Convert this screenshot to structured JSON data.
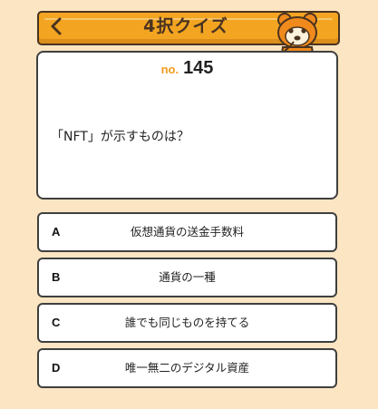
{
  "header": {
    "title": "4択クイズ",
    "back_icon": "chevron-left-icon"
  },
  "question": {
    "number_label": "no.",
    "number": "145",
    "text": "「NFT」が示すものは？"
  },
  "answers": [
    {
      "letter": "A",
      "text": "仮想通貨の送金手数料"
    },
    {
      "letter": "B",
      "text": "通貨の一種"
    },
    {
      "letter": "C",
      "text": "誰でも同じものを持てる"
    },
    {
      "letter": "D",
      "text": "唯一無二のデジタル資産"
    }
  ],
  "colors": {
    "background": "#fbe5c2",
    "banner": "#f3a521",
    "accent": "#f39c1a",
    "border": "#3f3f3f"
  },
  "mascot_icon": "raccoon-dog-mascot-icon"
}
